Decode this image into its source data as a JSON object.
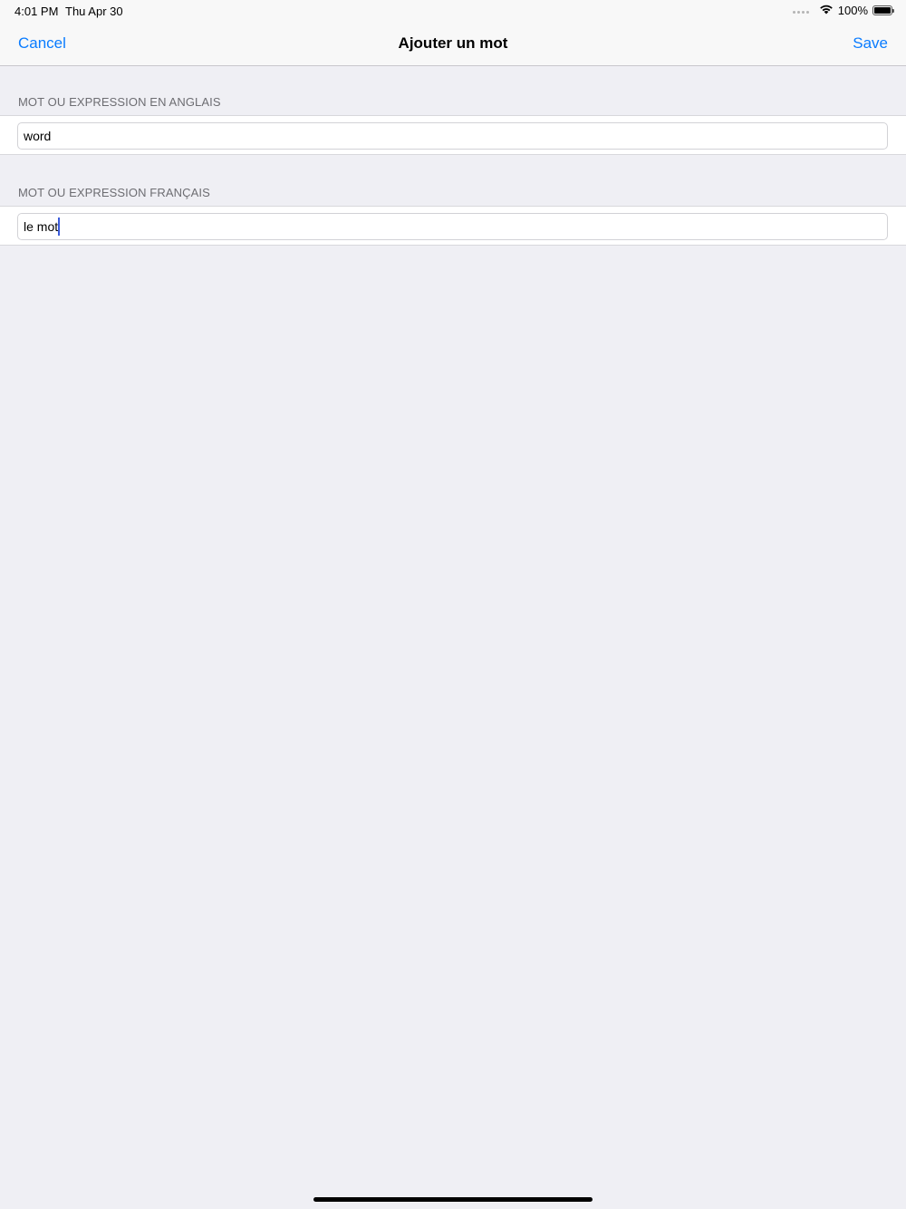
{
  "status_bar": {
    "time": "4:01 PM",
    "date": "Thu Apr 30",
    "battery_percent": "100%",
    "battery_level": 1.0,
    "icons": [
      "signal-dots-icon",
      "wifi-icon",
      "battery-icon"
    ]
  },
  "navigation": {
    "cancel_label": "Cancel",
    "title": "Ajouter un mot",
    "save_label": "Save"
  },
  "form": {
    "sections": [
      {
        "header": "MOT OU EXPRESSION EN ANGLAIS",
        "value": "word"
      },
      {
        "header": "MOT OU EXPRESSION FRANÇAIS",
        "value": "le mot"
      }
    ]
  },
  "colors": {
    "accent": "#0a7cff",
    "background": "#efeff4",
    "header_background": "#f8f8f8",
    "section_header_text": "#6d6d72",
    "caret": "#3b5bdb"
  }
}
